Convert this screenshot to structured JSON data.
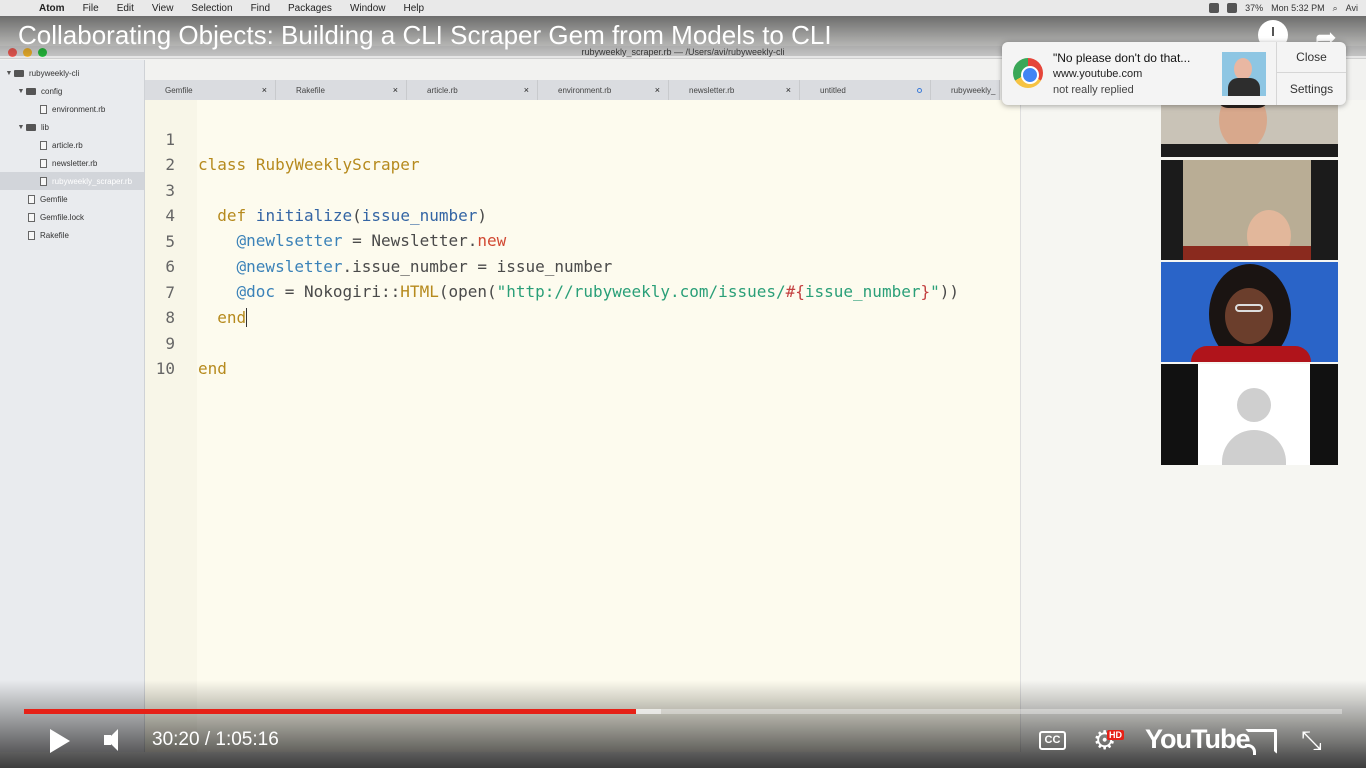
{
  "menubar": {
    "items": [
      "Atom",
      "File",
      "Edit",
      "View",
      "Selection",
      "Find",
      "Packages",
      "Window",
      "Help"
    ],
    "battery": "37%",
    "clock": "Mon 5:32 PM",
    "user": "Avi"
  },
  "video_title": "Collaborating Objects: Building a CLI Scraper Gem from Models to CLI",
  "atom": {
    "window_title": "rubyweekly_scraper.rb — /Users/avi/rubyweekly-cli",
    "tree": [
      {
        "label": "rubyweekly-cli",
        "type": "folder",
        "depth": 0
      },
      {
        "label": "config",
        "type": "folder",
        "depth": 1
      },
      {
        "label": "environment.rb",
        "type": "file",
        "depth": 2
      },
      {
        "label": "lib",
        "type": "folder",
        "depth": 1
      },
      {
        "label": "article.rb",
        "type": "file",
        "depth": 2
      },
      {
        "label": "newsletter.rb",
        "type": "file",
        "depth": 2
      },
      {
        "label": "rubyweekly_scraper.rb",
        "type": "file",
        "depth": 2,
        "selected": true
      },
      {
        "label": "Gemfile",
        "type": "file",
        "depth": 1
      },
      {
        "label": "Gemfile.lock",
        "type": "file",
        "depth": 1
      },
      {
        "label": "Rakefile",
        "type": "file",
        "depth": 1
      }
    ],
    "tabs": [
      "Gemfile",
      "Rakefile",
      "article.rb",
      "environment.rb",
      "newsletter.rb",
      "untitled",
      "rubyweekly_"
    ],
    "line_numbers": [
      "1",
      "2",
      "3",
      "4",
      "5",
      "6",
      "7",
      "8",
      "9",
      "10"
    ],
    "code": {
      "l1_kw": "class",
      "l1_name": "RubyWeeklyScraper",
      "l3_kw": "def",
      "l3_fn": "initialize",
      "l3_paren_open": "(",
      "l3_arg": "issue_number",
      "l3_paren_close": ")",
      "l4_ivar": "@newlsetter",
      "l4_eq": " = ",
      "l4_const": "Newsletter.",
      "l4_method": "new",
      "l5_ivar": "@newsletter",
      "l5_rest": ".issue_number = issue_number",
      "l6_ivar": "@doc",
      "l6_eq": " = Nokogiri::",
      "l6_html": "HTML",
      "l6_open": "(open(",
      "l6_str": "\"http://rubyweekly.com/issues/",
      "l6_interp_open": "#{",
      "l6_interp_var": "issue_number",
      "l6_interp_close": "}",
      "l6_str_end": "\"",
      "l6_close": "))",
      "l7": "end",
      "l9": "end"
    }
  },
  "notification": {
    "title": "\"No please don't do that...",
    "site": "www.youtube.com",
    "body": "not really replied",
    "close_label": "Close",
    "settings_label": "Settings"
  },
  "player": {
    "current_time": "30:20",
    "separator": " / ",
    "duration": "1:05:16",
    "progress_played": 0.464,
    "progress_buffered": 0.483,
    "cc_label": "CC",
    "hd_label": "HD",
    "logo_text": "YouTube"
  },
  "colors": {
    "progress": "#e62117",
    "editor_bg": "#fdfbee"
  }
}
